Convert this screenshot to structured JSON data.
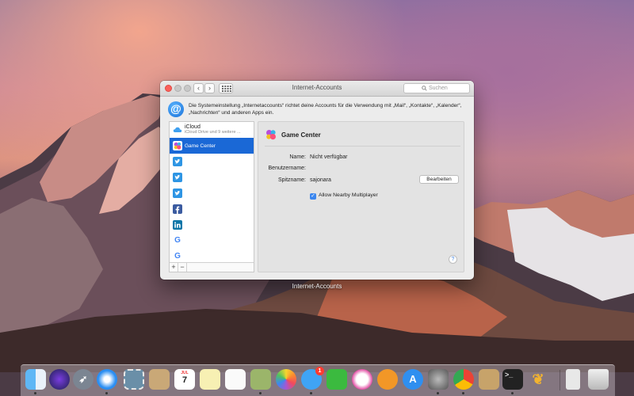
{
  "window": {
    "title": "Internet-Accounts",
    "search_placeholder": "Suchen",
    "header_icon": "@",
    "header_text": "Die Systemeinstellung „Internetaccounts“ richtet deine Accounts für die Verwendung mit „Mail“, „Kontakte“, „Kalender“, „Nachrichten“ und anderen Apps ein."
  },
  "sidebar": {
    "items": [
      {
        "label": "iCloud",
        "sublabel": "iCloud Drive und 9 weitere ...",
        "icon": "icloud-icon"
      },
      {
        "label": "Game Center",
        "icon": "game-center-icon",
        "selected": true
      },
      {
        "label": "",
        "icon": "twitter-icon"
      },
      {
        "label": "",
        "icon": "twitter-icon"
      },
      {
        "label": "",
        "icon": "twitter-icon"
      },
      {
        "label": "",
        "icon": "facebook-icon"
      },
      {
        "label": "",
        "icon": "linkedin-icon"
      },
      {
        "label": "",
        "icon": "google-icon"
      },
      {
        "label": "",
        "icon": "google-icon"
      }
    ],
    "add_label": "+",
    "remove_label": "−"
  },
  "detail": {
    "title": "Game Center",
    "name_label": "Name:",
    "name_value": "Nicht verfügbar",
    "username_label": "Benutzername:",
    "username_value": "",
    "nickname_label": "Spitzname:",
    "nickname_value": "sajonara",
    "edit_button": "Bearbeiten",
    "checkbox_label": "Allow Nearby Multiplayer",
    "checkbox_checked": true,
    "help_label": "?"
  },
  "dock_hover_label": "Internet-Accounts",
  "dock": {
    "messages_badge": "1",
    "calendar_month": "JUL",
    "calendar_day": "7",
    "items": [
      "finder-icon",
      "siri-icon",
      "launchpad-icon",
      "safari-icon",
      "mail-stamp-icon",
      "contacts-icon",
      "calendar-icon",
      "notes-icon",
      "reminders-icon",
      "photos-editor-icon",
      "photos-icon",
      "messages-icon",
      "facetime-icon",
      "itunes-icon",
      "ibooks-icon",
      "app-store-icon",
      "system-preferences-icon",
      "chrome-icon",
      "preview-icon",
      "terminal-icon",
      "tes-icon",
      "archive-icon",
      "trash-icon"
    ]
  },
  "colors": {
    "selection": "#1a68d6",
    "close_button": "#fc605b",
    "checkbox": "#3b86ee"
  }
}
